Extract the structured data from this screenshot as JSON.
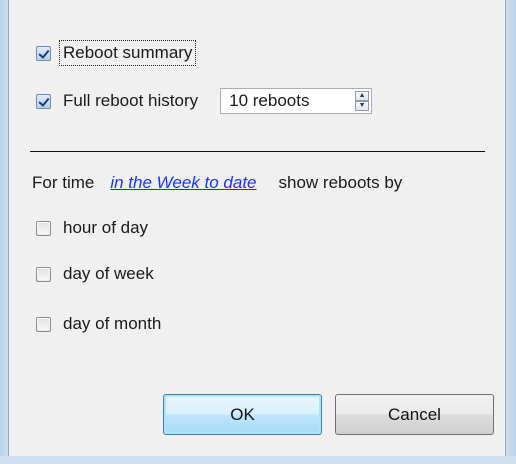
{
  "options": {
    "reboot_summary": {
      "label": "Reboot summary",
      "checked": true
    },
    "full_history": {
      "label": "Full reboot history",
      "checked": true
    },
    "spinner_value": "10 reboots",
    "spinner_up": "▲",
    "spinner_down": "▼"
  },
  "time_filter": {
    "prefix": "For time",
    "link": "in the Week to date",
    "suffix": "show reboots by"
  },
  "group_by": [
    {
      "label": "hour of day",
      "checked": false
    },
    {
      "label": "day of week",
      "checked": false
    },
    {
      "label": "day of month",
      "checked": false
    }
  ],
  "buttons": {
    "ok": "OK",
    "cancel": "Cancel"
  },
  "colors": {
    "link": "#1a33ff",
    "default_button_border": "#3c7fb1"
  }
}
